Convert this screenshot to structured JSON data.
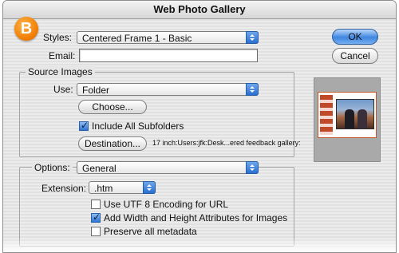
{
  "window": {
    "title": "Web Photo Gallery"
  },
  "badge": {
    "letter": "B"
  },
  "styles": {
    "label": "Styles:",
    "value": "Centered Frame 1 - Basic"
  },
  "email": {
    "label": "Email:",
    "value": ""
  },
  "source_images": {
    "title": "Source Images",
    "use_label": "Use:",
    "use_value": "Folder",
    "choose_button": "Choose...",
    "include_subfolders": {
      "label": "Include All Subfolders",
      "checked": true
    },
    "destination_button": "Destination...",
    "destination_path": "17 inch:Users:jfk:Desk...ered feedback gallery:"
  },
  "options": {
    "label": "Options:",
    "value": "General",
    "extension_label": "Extension:",
    "extension_value": ".htm",
    "checkboxes": [
      {
        "label": "Use UTF 8 Encoding for URL",
        "checked": false
      },
      {
        "label": "Add Width and Height Attributes for Images",
        "checked": true
      },
      {
        "label": "Preserve all metadata",
        "checked": false
      }
    ]
  },
  "buttons": {
    "ok": "OK",
    "cancel": "Cancel"
  },
  "colors": {
    "accent": "#3f86e0",
    "badge": "#f07a00"
  }
}
